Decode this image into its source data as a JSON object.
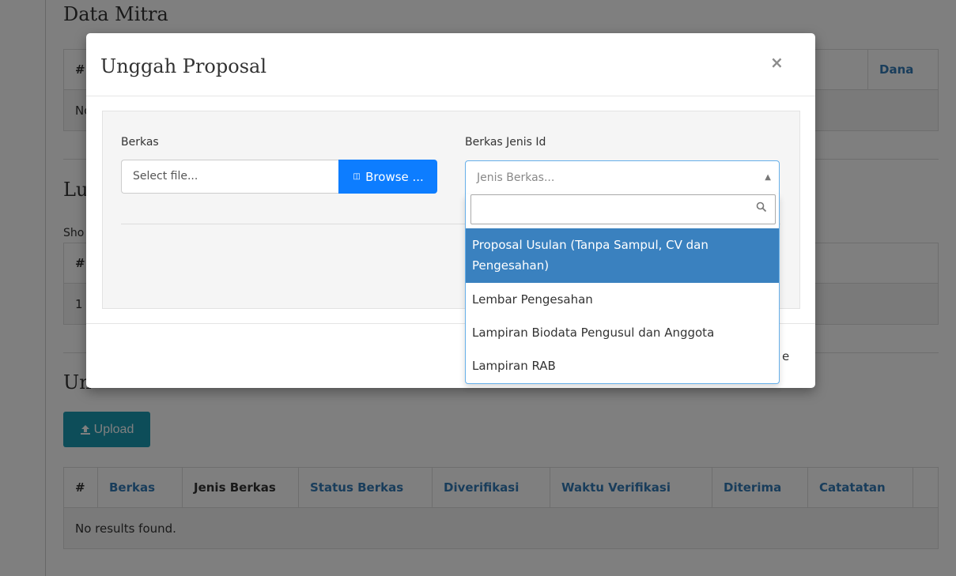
{
  "background": {
    "data_mitra_title": "Data Mitra",
    "mitra_table": {
      "hash": "#",
      "dana": "Dana",
      "row_fragment": "No"
    },
    "luaran_title_fragment": "Lu",
    "show_fragment": "Sho",
    "luaran_table": {
      "hash": "#",
      "row_number": "1"
    },
    "unggah_title_fragment": "Un",
    "upload_button_label": "Upload",
    "berkas_table": {
      "headers": [
        "#",
        "Berkas",
        "Jenis Berkas",
        "Status Berkas",
        "Diverifikasi",
        "Waktu Verifikasi",
        "Diterima",
        "Catatatan",
        ""
      ],
      "empty_message": "No results found."
    }
  },
  "modal": {
    "title": "Unggah Proposal",
    "close_label": "×",
    "berkas_label": "Berkas",
    "file_placeholder": "Select file...",
    "browse_label": "Browse ...",
    "jenis_label": "Berkas Jenis Id",
    "select_placeholder": "Jenis Berkas...",
    "footer_fragment": "e",
    "options": [
      "Proposal Usulan (Tanpa Sampul, CV dan Pengesahan)",
      "Lembar Pengesahan",
      "Lampiran Biodata Pengusul dan Anggota",
      "Lampiran RAB"
    ]
  },
  "colors": {
    "accent": "#337ab7",
    "browse": "#0d7dff",
    "upload": "#1a9bb3",
    "highlight": "#3a81bf"
  }
}
